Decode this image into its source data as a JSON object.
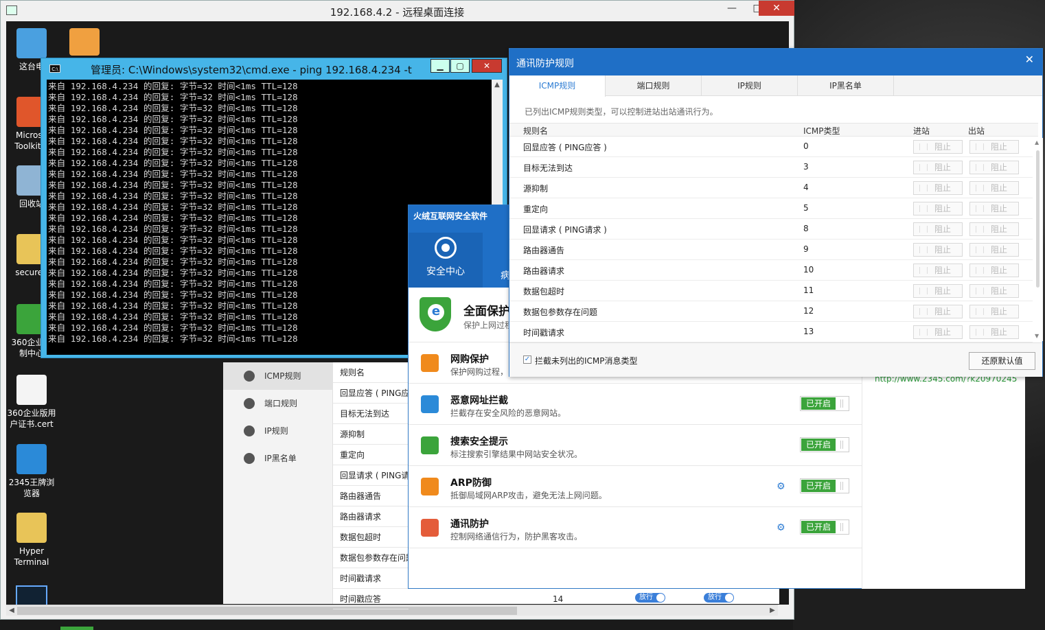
{
  "rdp": {
    "title": "192.168.4.2 - 远程桌面连接",
    "min": "—",
    "max": "□",
    "close": "✕",
    "sub_close": "✕"
  },
  "desktop_icons": [
    {
      "label": "这台电",
      "name": "this-pc-icon",
      "color": "#4aa0e0"
    },
    {
      "label": "Microso Toolkit.e",
      "name": "office-toolkit-icon",
      "color": "#e0562b"
    },
    {
      "label": "回收站",
      "name": "recycle-bin-icon",
      "color": "#8fb4d4"
    },
    {
      "label": "secured",
      "name": "folder-icon",
      "color": "#e8c458"
    },
    {
      "label": "360企业版 制中心",
      "name": "360-control-icon",
      "color": "#3ba43b"
    },
    {
      "label": "360企业版用 户证书.cert",
      "name": "file-icon",
      "color": "#f4f4f4"
    },
    {
      "label": "2345王牌浏 览器",
      "name": "browser-icon",
      "color": "#2b8ad8"
    },
    {
      "label": "Hyper Terminal",
      "name": "folder-icon",
      "color": "#e8c458"
    }
  ],
  "cmd": {
    "title": "管理员: C:\\Windows\\system32\\cmd.exe - ping  192.168.4.234 -t",
    "icon_text": "C:\\",
    "line": "来自 192.168.4.234 的回复: 字节=32 时间<1ms TTL=128",
    "min": "▁",
    "max": "▢",
    "close": "✕",
    "scroll_up": "▲"
  },
  "fw_left_menu": [
    {
      "label": "ICMP规则",
      "active": true
    },
    {
      "label": "端口规则",
      "active": false
    },
    {
      "label": "IP规则",
      "active": false
    },
    {
      "label": "IP黑名单",
      "active": false
    }
  ],
  "fw_bg_rows": [
    "规则名",
    "回显应答 ( PING应",
    "目标无法到达",
    "源抑制",
    "重定向",
    "回显请求 ( PING请",
    "路由器通告",
    "路由器请求",
    "数据包超时",
    "数据包参数存在问题",
    "时间戳请求",
    "时间戳应答"
  ],
  "fw_bottom": {
    "type": "14",
    "in": "放行",
    "out": "放行"
  },
  "security": {
    "title": "火绒互联网安全软件",
    "nav": [
      "安全中心",
      "病"
    ],
    "banner_title": "全面保护",
    "banner_sub": "保护上网过程",
    "link": "http://www.2345.com/?k20970245",
    "items": [
      {
        "name": "网购保护",
        "desc": "保护网购过程，",
        "status": "",
        "gear": false,
        "color": "#f08a1c"
      },
      {
        "name": "恶意网址拦截",
        "desc": "拦截存在安全风险的恶意网站。",
        "status": "已开启",
        "gear": false,
        "color": "#2b8ad8"
      },
      {
        "name": "搜索安全提示",
        "desc": "标注搜索引擎结果中网站安全状况。",
        "status": "已开启",
        "gear": false,
        "color": "#3ba43b"
      },
      {
        "name": "ARP防御",
        "desc": "抵御局域网ARP攻击，避免无法上网问题。",
        "status": "已开启",
        "gear": true,
        "color": "#f08a1c"
      },
      {
        "name": "通讯防护",
        "desc": "控制网络通信行为，防护黑客攻击。",
        "status": "已开启",
        "gear": true,
        "color": "#e45c3a"
      }
    ],
    "gear_icon": "⚙"
  },
  "dialog": {
    "title": "通讯防护规则",
    "close": "✕",
    "tabs": [
      "ICMP规则",
      "端口规则",
      "IP规则",
      "IP黑名单"
    ],
    "description": "已列出ICMP规则类型，可以控制进站出站通讯行为。",
    "headers": {
      "name": "规则名",
      "type": "ICMP类型",
      "in": "进站",
      "out": "出站"
    },
    "block_label": "阻止",
    "rows": [
      {
        "name": "回显应答 ( PING应答 )",
        "type": "0"
      },
      {
        "name": "目标无法到达",
        "type": "3"
      },
      {
        "name": "源抑制",
        "type": "4"
      },
      {
        "name": "重定向",
        "type": "5"
      },
      {
        "name": "回显请求 ( PING请求 )",
        "type": "8"
      },
      {
        "name": "路由器通告",
        "type": "9"
      },
      {
        "name": "路由器请求",
        "type": "10"
      },
      {
        "name": "数据包超时",
        "type": "11"
      },
      {
        "name": "数据包参数存在问题",
        "type": "12"
      },
      {
        "name": "时间戳请求",
        "type": "13"
      }
    ],
    "checkbox_checked": true,
    "checkbox_mark": "✓",
    "checkbox_label": "拦截未列出的ICMP消息类型",
    "restore": "还原默认值"
  }
}
